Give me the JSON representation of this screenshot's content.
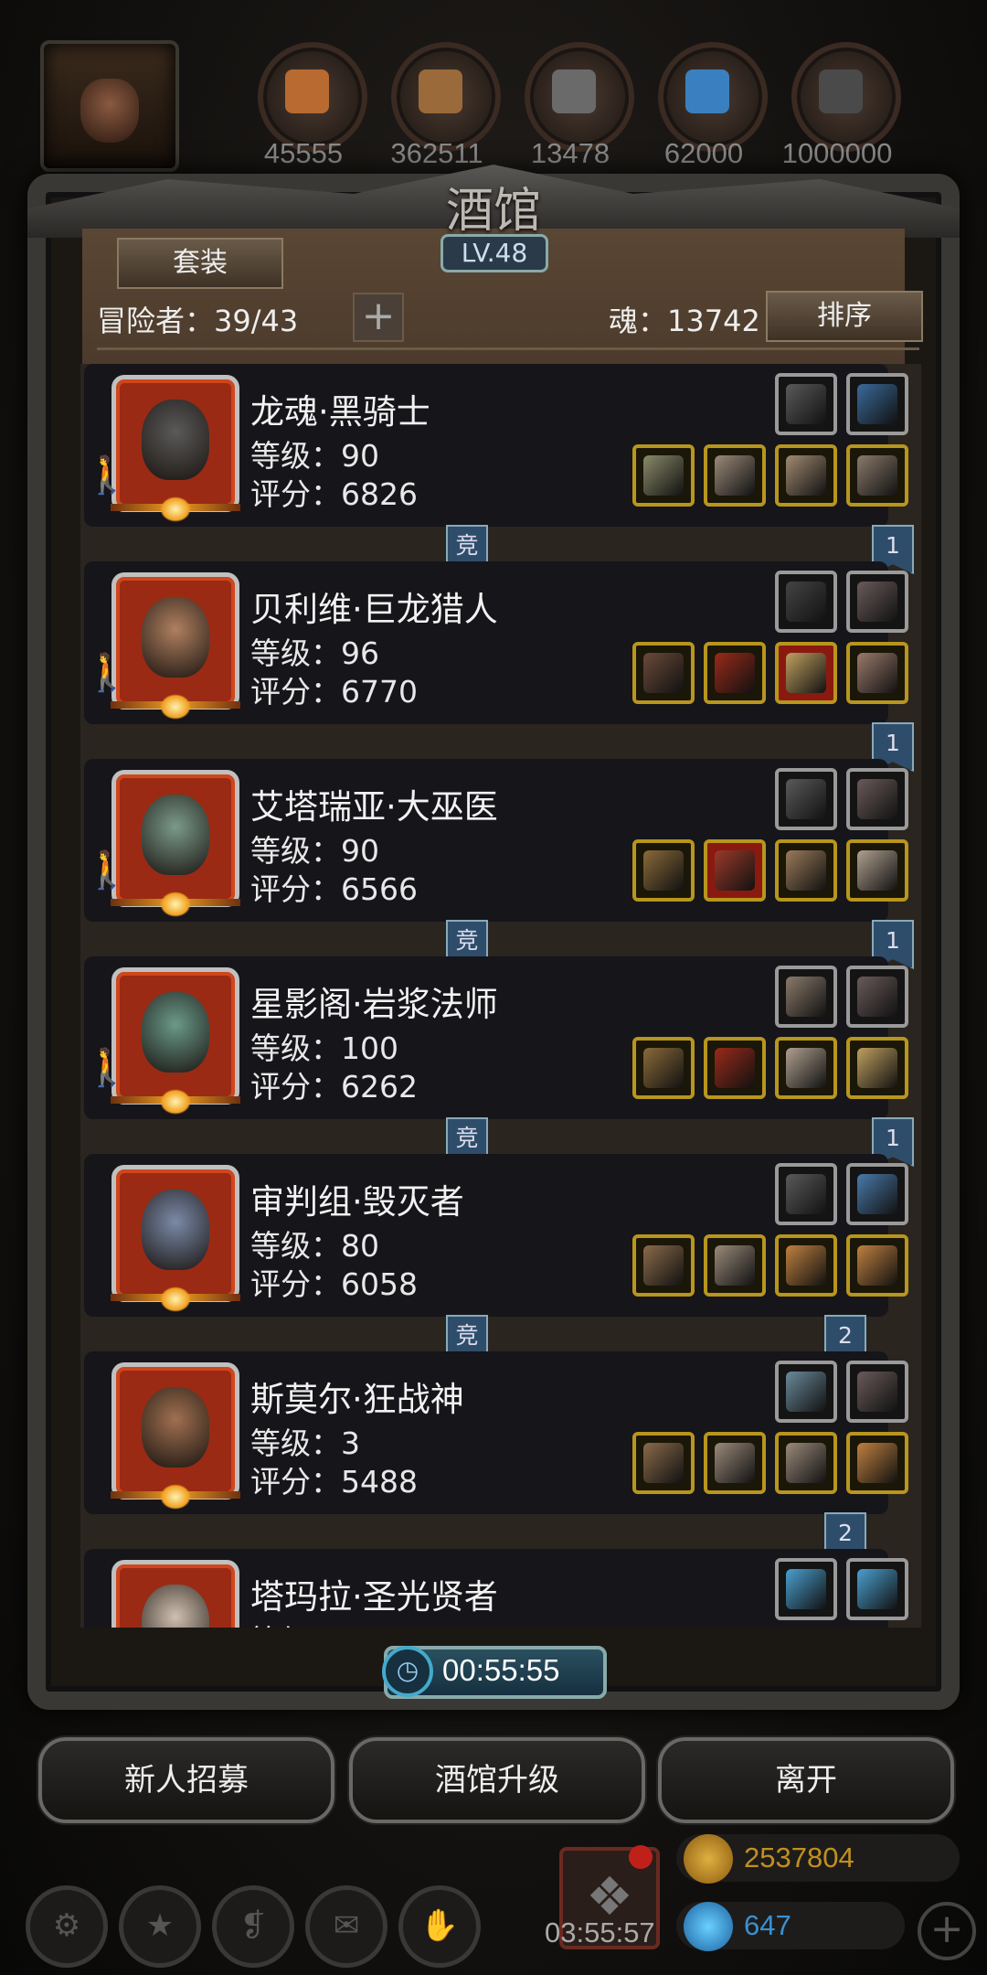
{
  "top_resources": {
    "items": [
      {
        "icon": "meat-icon",
        "value": "45555",
        "color": "#b86a30"
      },
      {
        "icon": "wood-icon",
        "value": "362511",
        "color": "#9a6a3a"
      },
      {
        "icon": "iron-icon",
        "value": "13478",
        "color": "#6a6a6a"
      },
      {
        "icon": "crystal-icon",
        "value": "62000",
        "color": "#3a80c0"
      },
      {
        "icon": "ore-icon",
        "value": "1000000",
        "color": "#4a4a4a"
      }
    ]
  },
  "tavern": {
    "title": "酒馆",
    "level": "LV.48",
    "set_button": "套装",
    "adventurers_label": "冒险者：39/43",
    "plus_button": "+",
    "soul_label": "魂：13742",
    "sort_button": "排序"
  },
  "heroes": [
    {
      "name": "龙魂·黑骑士",
      "level": "等级：90",
      "score": "评分：6826",
      "face_color": "#5a5a5a",
      "competitive": "竞",
      "rank": "1",
      "equip_top": [
        {
          "icon": "helm-wing-icon",
          "color": "#5a5a5a"
        },
        {
          "icon": "bow-icon",
          "color": "#3a6a9a"
        }
      ],
      "equip_bottom": [
        {
          "icon": "spear-icon",
          "color": "#8a8a6a",
          "frame": "gold"
        },
        {
          "icon": "armor-icon",
          "color": "#9a8a7a",
          "frame": "gold"
        },
        {
          "icon": "skull-mask-icon",
          "color": "#a08a70",
          "frame": "gold"
        },
        {
          "icon": "helmet-icon",
          "color": "#8a7a6a",
          "frame": "gold"
        }
      ]
    },
    {
      "name": "贝利维·巨龙猎人",
      "level": "等级：96",
      "score": "评分：6770",
      "face_color": "#b08060",
      "competitive": "",
      "rank": "1",
      "equip_top": [
        {
          "icon": "gauntlet-icon",
          "color": "#444"
        },
        {
          "icon": "feather-icon",
          "color": "#6a5a5a"
        }
      ],
      "equip_bottom": [
        {
          "icon": "rifle-icon",
          "color": "#6a4a3a",
          "frame": "gold"
        },
        {
          "icon": "cloak-icon",
          "color": "#9a2a1a",
          "frame": "gold"
        },
        {
          "icon": "ring-shield-icon",
          "color": "#c0a060",
          "frame": "red"
        },
        {
          "icon": "boots-icon",
          "color": "#9a7a6a",
          "frame": "gold"
        }
      ]
    },
    {
      "name": "艾塔瑞亚·大巫医",
      "level": "等级：90",
      "score": "评分：6566",
      "face_color": "#7a9a8a",
      "competitive": "竞",
      "rank": "1",
      "equip_top": [
        {
          "icon": "feather-icon",
          "color": "#5a5a5a"
        },
        {
          "icon": "feather-icon",
          "color": "#6a5a5a"
        }
      ],
      "equip_bottom": [
        {
          "icon": "staff-icon",
          "color": "#8a6a3a",
          "frame": "gold"
        },
        {
          "icon": "robe-icon",
          "color": "#9a3a2a",
          "frame": "red"
        },
        {
          "icon": "boots-icon",
          "color": "#9a7a5a",
          "frame": "gold"
        },
        {
          "icon": "vest-icon",
          "color": "#b0a090",
          "frame": "gold"
        }
      ]
    },
    {
      "name": "星影阁·岩浆法师",
      "level": "等级：100",
      "score": "评分：6262",
      "face_color": "#6a9a8a",
      "competitive": "竞",
      "rank": "1",
      "equip_top": [
        {
          "icon": "shield-icon",
          "color": "#8a7a6a"
        },
        {
          "icon": "feather-icon",
          "color": "#6a5a5a"
        }
      ],
      "equip_bottom": [
        {
          "icon": "staff-icon",
          "color": "#8a6a3a",
          "frame": "gold"
        },
        {
          "icon": "cloak-icon",
          "color": "#9a2a1a",
          "frame": "gold"
        },
        {
          "icon": "vest-icon",
          "color": "#b0a090",
          "frame": "gold"
        },
        {
          "icon": "necklace-icon",
          "color": "#c0a060",
          "frame": "gold"
        }
      ]
    },
    {
      "name": "审判组·毁灭者",
      "level": "等级：80",
      "score": "评分：6058",
      "face_color": "#7a8aa8",
      "competitive": "竞",
      "rank": "2",
      "equip_top": [
        {
          "icon": "gauntlet-icon",
          "color": "#5a5a5a"
        },
        {
          "icon": "amulet-icon",
          "color": "#4a7aaa"
        }
      ],
      "equip_bottom": [
        {
          "icon": "axe-icon",
          "color": "#8a6a4a",
          "frame": "gold"
        },
        {
          "icon": "armor-icon",
          "color": "#9a8a7a",
          "frame": "gold"
        },
        {
          "icon": "ring-icon",
          "color": "#c08040",
          "frame": "gold"
        },
        {
          "icon": "ring-icon",
          "color": "#c08040",
          "frame": "gold"
        }
      ]
    },
    {
      "name": "斯莫尔·狂战神",
      "level": "等级：3",
      "score": "评分：5488",
      "face_color": "#a07050",
      "competitive": "",
      "rank": "2",
      "equip_top": [
        {
          "icon": "emblem-icon",
          "color": "#6a8a9a"
        },
        {
          "icon": "feather-icon",
          "color": "#6a5a5a"
        }
      ],
      "equip_bottom": [
        {
          "icon": "axe-icon",
          "color": "#8a6a4a",
          "frame": "gold"
        },
        {
          "icon": "armor-icon",
          "color": "#9a8a7a",
          "frame": "gold"
        },
        {
          "icon": "bracer-icon",
          "color": "#9a8a7a",
          "frame": "gold"
        },
        {
          "icon": "ring-icon",
          "color": "#c08040",
          "frame": "gold"
        }
      ]
    },
    {
      "name": "塔玛拉·圣光贤者",
      "level": "等级",
      "score": "",
      "face_color": "#d0c0b0",
      "competitive": "",
      "rank": "",
      "equip_top": [
        {
          "icon": "frost-boots-icon",
          "color": "#4aa0d0"
        },
        {
          "icon": "frost-boots-icon",
          "color": "#4aa0d0"
        }
      ],
      "equip_bottom": []
    }
  ],
  "timer": "00:55:55",
  "buttons": {
    "recruit": "新人招募",
    "upgrade": "酒馆升级",
    "leave": "离开"
  },
  "footer": {
    "gift_timer": "03:55:57",
    "gold": "2537804",
    "gems": "647",
    "icons": [
      "settings-icon",
      "star-icon",
      "scroll-icon",
      "mail-icon",
      "handshake-icon"
    ]
  }
}
